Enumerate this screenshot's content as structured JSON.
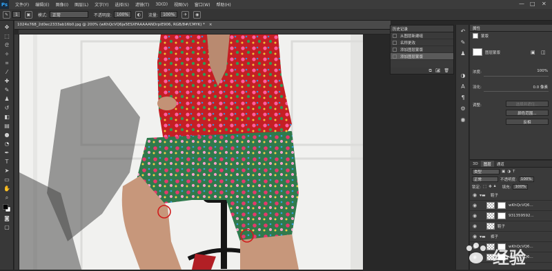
{
  "app": {
    "logo": "Ps"
  },
  "menu": [
    "文件(F)",
    "编辑(E)",
    "图像(I)",
    "图层(L)",
    "文字(Y)",
    "选择(S)",
    "滤镜(T)",
    "3D(D)",
    "视图(V)",
    "窗口(W)",
    "帮助(H)"
  ],
  "window_controls": {
    "minimize": "—",
    "maximize": "□",
    "close": "✕"
  },
  "options": {
    "brush_size": "1",
    "mode_label": "模式:",
    "mode_value": "正常",
    "opacity_label": "不透明度:",
    "opacity_value": "100%",
    "flow_label": "流量:",
    "flow_value": "100%"
  },
  "document": {
    "tab_title": "1024x768_2d0ec2333ab16b0.jpg @ 200% (wKhQcVQ6ja5ESXFAAAAANDrpiE906, RGB/8#/CMYK) *"
  },
  "history": {
    "tab": "历史记录",
    "items": [
      "从图层新建组",
      "名称更改",
      "添加图层蒙版",
      "添加图层蒙版"
    ],
    "selected_index": 3
  },
  "properties": {
    "tab": "属性",
    "subtitle": "蒙版",
    "mask_label": "图层蒙版",
    "density_label": "浓度:",
    "density_value": "100%",
    "feather_label": "羽化:",
    "feather_value": "0.0 像素",
    "adjust_label": "调整:",
    "select_subject_btn": "选择并遮住...",
    "color_range_btn": "颜色范围...",
    "invert_btn": "反相"
  },
  "layers": {
    "tabs": [
      "3D",
      "图层",
      "通道"
    ],
    "filter_label": "类型",
    "blend_mode": "正常",
    "opacity_label": "不透明度:",
    "opacity_value": "100%",
    "lock_label": "锁定:",
    "fill_label": "填充:",
    "fill_value": "100%",
    "rows": [
      {
        "name": "鞋子",
        "type": "group"
      },
      {
        "name": "wKhQcVQ6...",
        "type": "layer"
      },
      {
        "name": "931359592...",
        "type": "layer"
      },
      {
        "name": "鞋子",
        "type": "layer"
      },
      {
        "name": "裤子",
        "type": "group"
      },
      {
        "name": "wKhQcVQ6...",
        "type": "layer"
      },
      {
        "name": "wKhQcVQ6...",
        "type": "layer"
      }
    ]
  },
  "watermark": {
    "text": "经验"
  },
  "colors": {
    "accent": "#31a8ff",
    "annotation": "#d01c1c",
    "floral_red": "#c41f24",
    "floral_green": "#2f7a4c"
  }
}
